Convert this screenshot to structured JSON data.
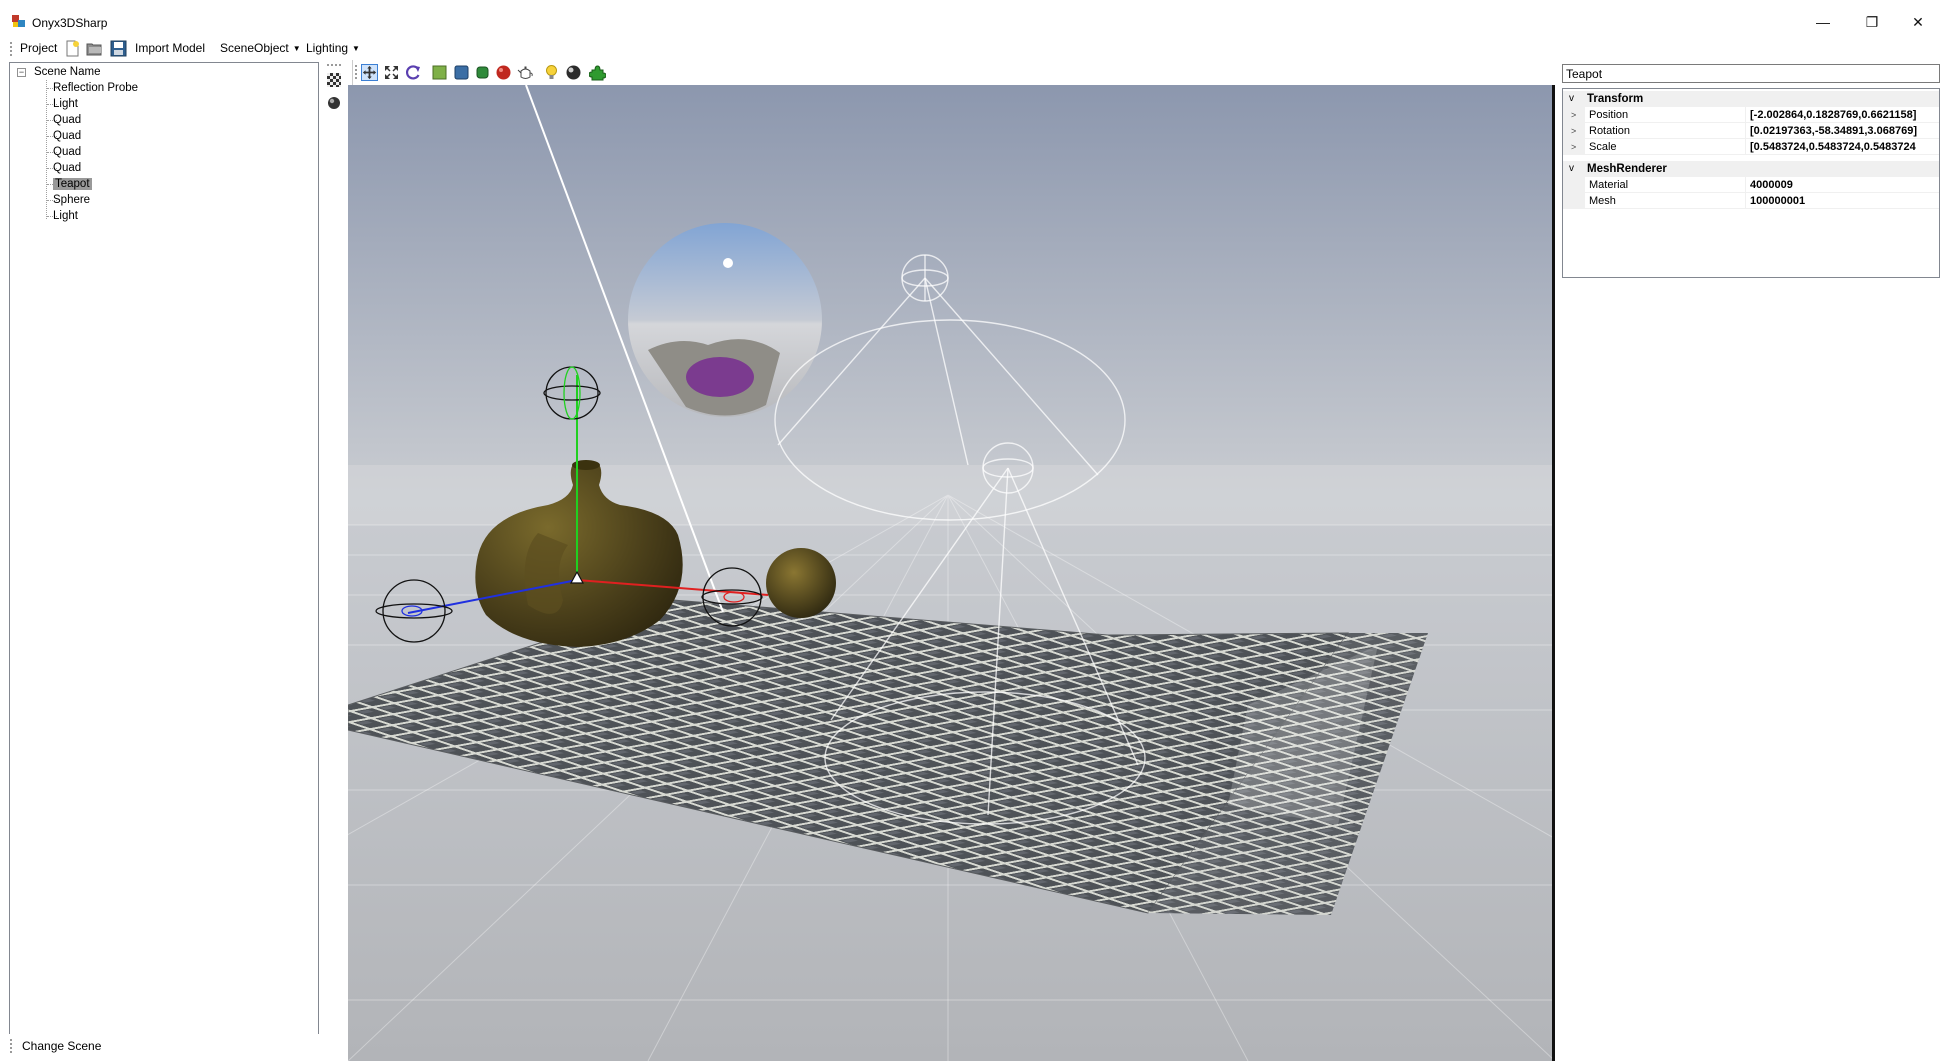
{
  "window": {
    "title": "Onyx3DSharp",
    "controls": {
      "minimize": "—",
      "restore": "❐",
      "close": "✕"
    }
  },
  "menubar": {
    "project": "Project",
    "import_model": "Import Model",
    "scene_object": "SceneObject",
    "lighting": "Lighting",
    "icons": [
      "new-file-icon",
      "open-folder-icon",
      "save-icon"
    ]
  },
  "scene_tree": {
    "root": "Scene Name",
    "expander": "−",
    "items": [
      {
        "label": "Reflection Probe",
        "selected": false
      },
      {
        "label": "Light",
        "selected": false
      },
      {
        "label": "Quad",
        "selected": false
      },
      {
        "label": "Quad",
        "selected": false
      },
      {
        "label": "Quad",
        "selected": false
      },
      {
        "label": "Quad",
        "selected": false
      },
      {
        "label": "Teapot",
        "selected": true
      },
      {
        "label": "Sphere",
        "selected": false
      },
      {
        "label": "Light",
        "selected": false
      }
    ]
  },
  "footer": {
    "change_scene": "Change Scene"
  },
  "viewport_toolbar": {
    "tools": [
      "move-tool-icon",
      "scale-tool-icon",
      "rotate-tool-icon",
      "add-quad-icon",
      "add-cube-icon",
      "add-cylinder-icon",
      "add-sphere-icon",
      "add-teapot-icon",
      "add-light-icon",
      "add-reflection-probe-icon",
      "add-component-icon"
    ]
  },
  "side_tools": [
    "texture-icon",
    "material-sphere-icon"
  ],
  "inspector": {
    "name_value": "Teapot",
    "categories": [
      {
        "name": "Transform",
        "chevron": "v",
        "props": [
          {
            "name": "Position",
            "value": "[-2.002864,0.1828769,0.6621158]",
            "expand": ">"
          },
          {
            "name": "Rotation",
            "value": "[0.02197363,-58.34891,3.068769]",
            "expand": ">"
          },
          {
            "name": "Scale",
            "value": "[0.5483724,0.5483724,0.5483724",
            "expand": ">"
          }
        ]
      },
      {
        "name": "MeshRenderer",
        "chevron": "v",
        "props": [
          {
            "name": "Material",
            "value": "4000009",
            "expand": ""
          },
          {
            "name": "Mesh",
            "value": "100000001",
            "expand": ""
          }
        ]
      }
    ]
  },
  "colors": {
    "sky_top": "#8c97ae",
    "horizon": "#c9ccd1",
    "ground": "#b2b4b8",
    "teapot": "#4a3f1a",
    "gizmo_x": "#e02020",
    "gizmo_y": "#20d020",
    "gizmo_z": "#2030e0",
    "selection": "#999999"
  }
}
